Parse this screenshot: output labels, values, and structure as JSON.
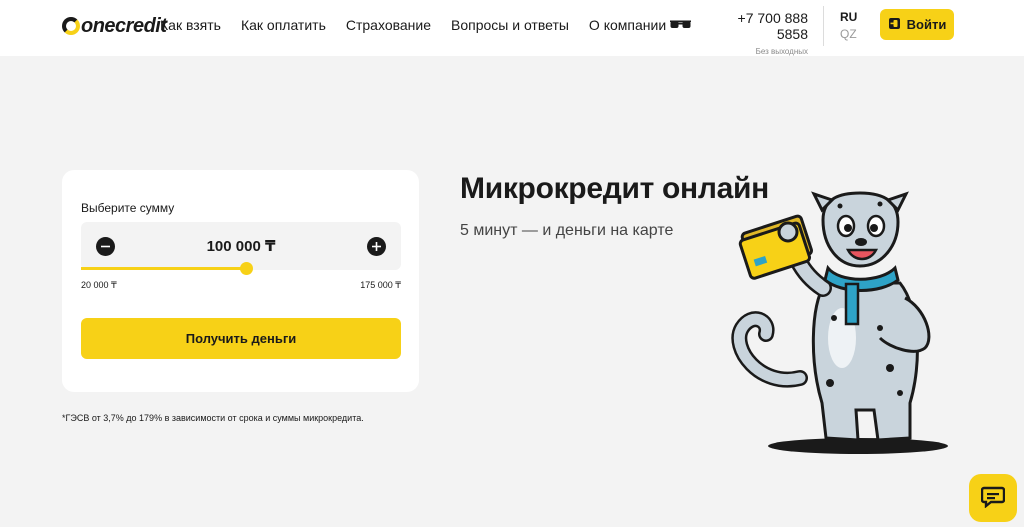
{
  "header": {
    "logo_text": "onecredit",
    "nav": [
      "Как взять",
      "Как оплатить",
      "Страхование",
      "Вопросы и ответы",
      "О компании"
    ],
    "accessibility_icon": "glasses-icon",
    "phone": "+7 700 888 5858",
    "phone_note": "Без выходных",
    "lang_active": "RU",
    "lang_other": "QZ",
    "login_label": "Войти"
  },
  "calculator": {
    "label": "Выберите сумму",
    "amount": "100 000 ₸",
    "min": "20 000 ₸",
    "max": "175 000 ₸",
    "slider_fraction": 0.516,
    "cta_label": "Получить деньги"
  },
  "footnote": "*ГЭСВ от 3,7% до 179% в зависимости от срока и суммы микрокредита.",
  "hero": {
    "title": "Микрокредит онлайн",
    "subtitle": "5 минут — и деньги на карте"
  },
  "colors": {
    "accent": "#f7d117",
    "background": "#f3f3f3",
    "text": "#1a1a1a"
  },
  "chat_icon": "chat-icon"
}
